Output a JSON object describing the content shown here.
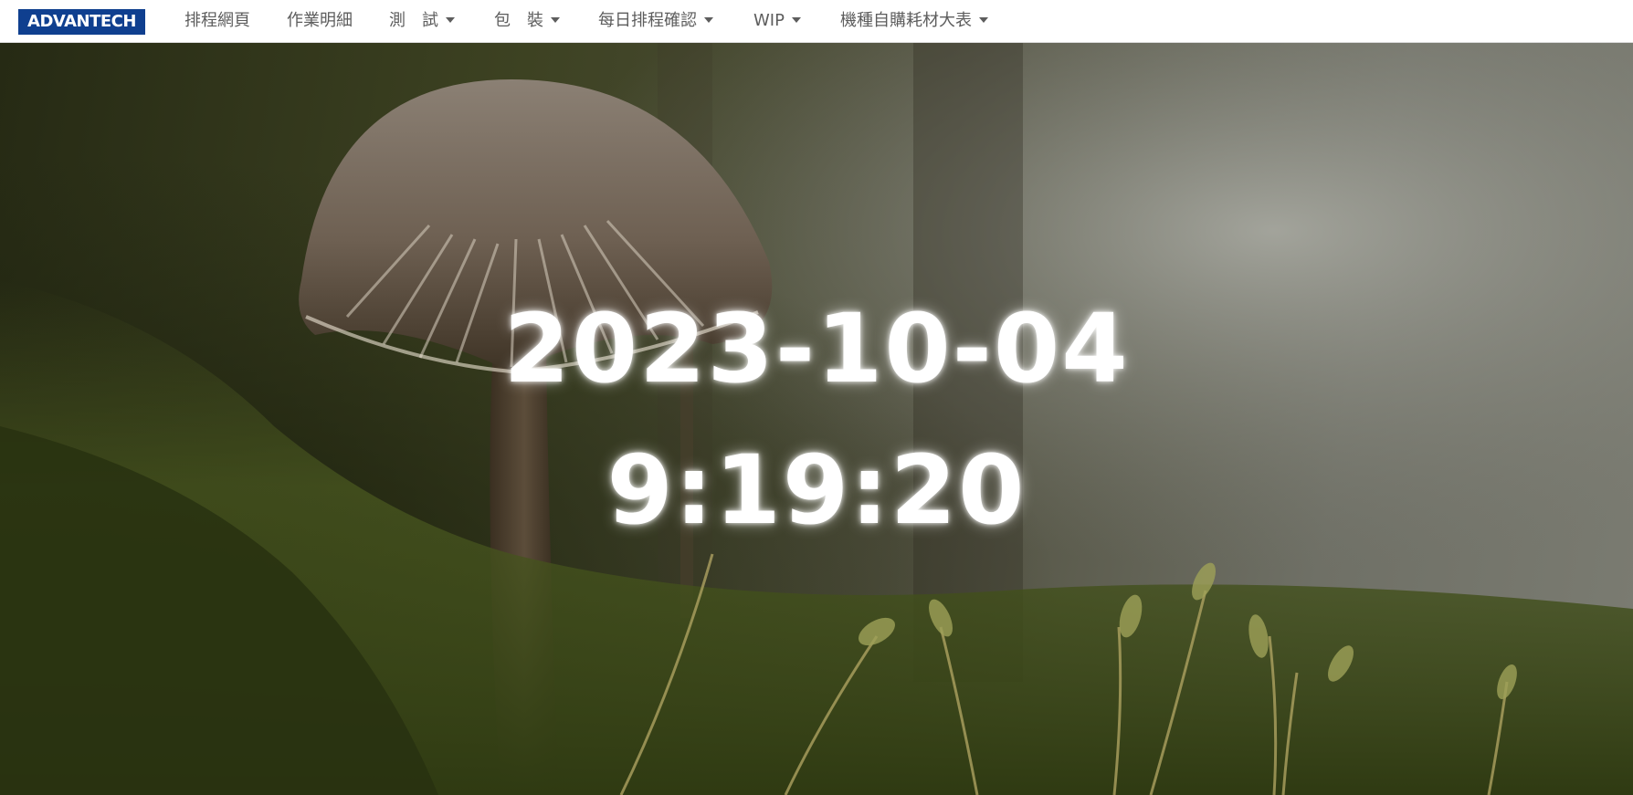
{
  "brand": {
    "logo_text": "ADVANTECH",
    "logo_color": "#0f3f8f"
  },
  "nav": {
    "items": [
      {
        "label": "排程網頁",
        "dropdown": false
      },
      {
        "label": "作業明細",
        "dropdown": false
      },
      {
        "label": "測　試",
        "dropdown": true
      },
      {
        "label": "包　裝",
        "dropdown": true
      },
      {
        "label": "每日排程確認",
        "dropdown": true
      },
      {
        "label": "WIP",
        "dropdown": true
      },
      {
        "label": "機種自購耗材大表",
        "dropdown": true
      }
    ]
  },
  "clock": {
    "date": "2023-10-04",
    "time": "9:19:20"
  },
  "background": {
    "description_icon": "mushroom-moss-photo",
    "tint": "#3d4222"
  }
}
